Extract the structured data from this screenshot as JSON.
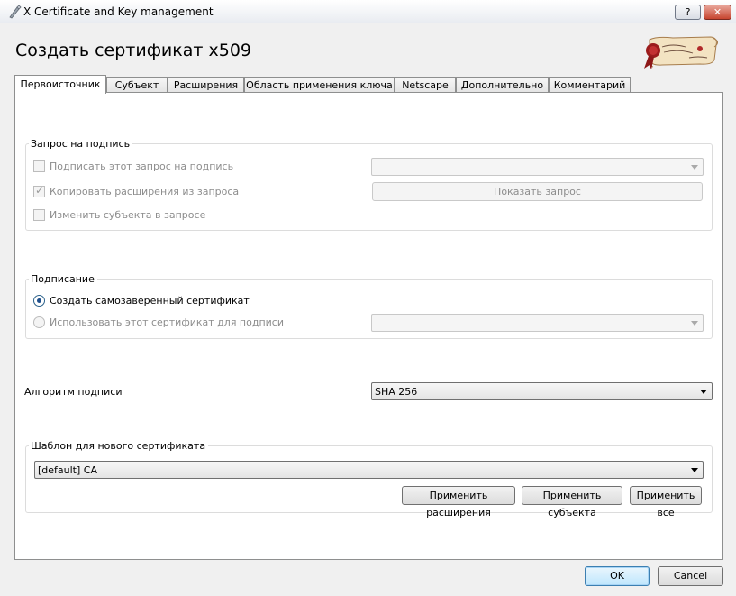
{
  "window": {
    "title": "X Certificate and Key management",
    "help_label": "?",
    "close_label": "✕"
  },
  "page_title": "Создать сертификат x509",
  "tabs": [
    {
      "label": "Первоисточник",
      "active": true
    },
    {
      "label": "Субъект"
    },
    {
      "label": "Расширения"
    },
    {
      "label": "Область применения ключа"
    },
    {
      "label": "Netscape"
    },
    {
      "label": "Дополнительно"
    },
    {
      "label": "Комментарий"
    }
  ],
  "signing_request": {
    "group_label": "Запрос на подпись",
    "sign_request_label": "Подписать этот запрос на подпись",
    "sign_request_checked": false,
    "copy_extensions_label": "Копировать расширения из запроса",
    "copy_extensions_checked": true,
    "modify_subject_label": "Изменить субъекта в запросе",
    "modify_subject_checked": false,
    "request_select_value": "",
    "show_request_label": "Показать запрос"
  },
  "signing": {
    "group_label": "Подписание",
    "self_signed_label": "Создать самозаверенный сертификат",
    "use_cert_label": "Использовать этот сертификат для подписи",
    "selected": "self_signed",
    "cert_select_value": ""
  },
  "signature_algorithm": {
    "label": "Алгоритм подписи",
    "value": "SHA 256"
  },
  "template": {
    "group_label": "Шаблон для нового сертификата",
    "value": "[default] CA",
    "apply_extensions_label": "Применить расширения",
    "apply_subject_label": "Применить субъекта",
    "apply_all_label": "Применить всё"
  },
  "footer": {
    "ok_label": "OK",
    "cancel_label": "Cancel"
  }
}
